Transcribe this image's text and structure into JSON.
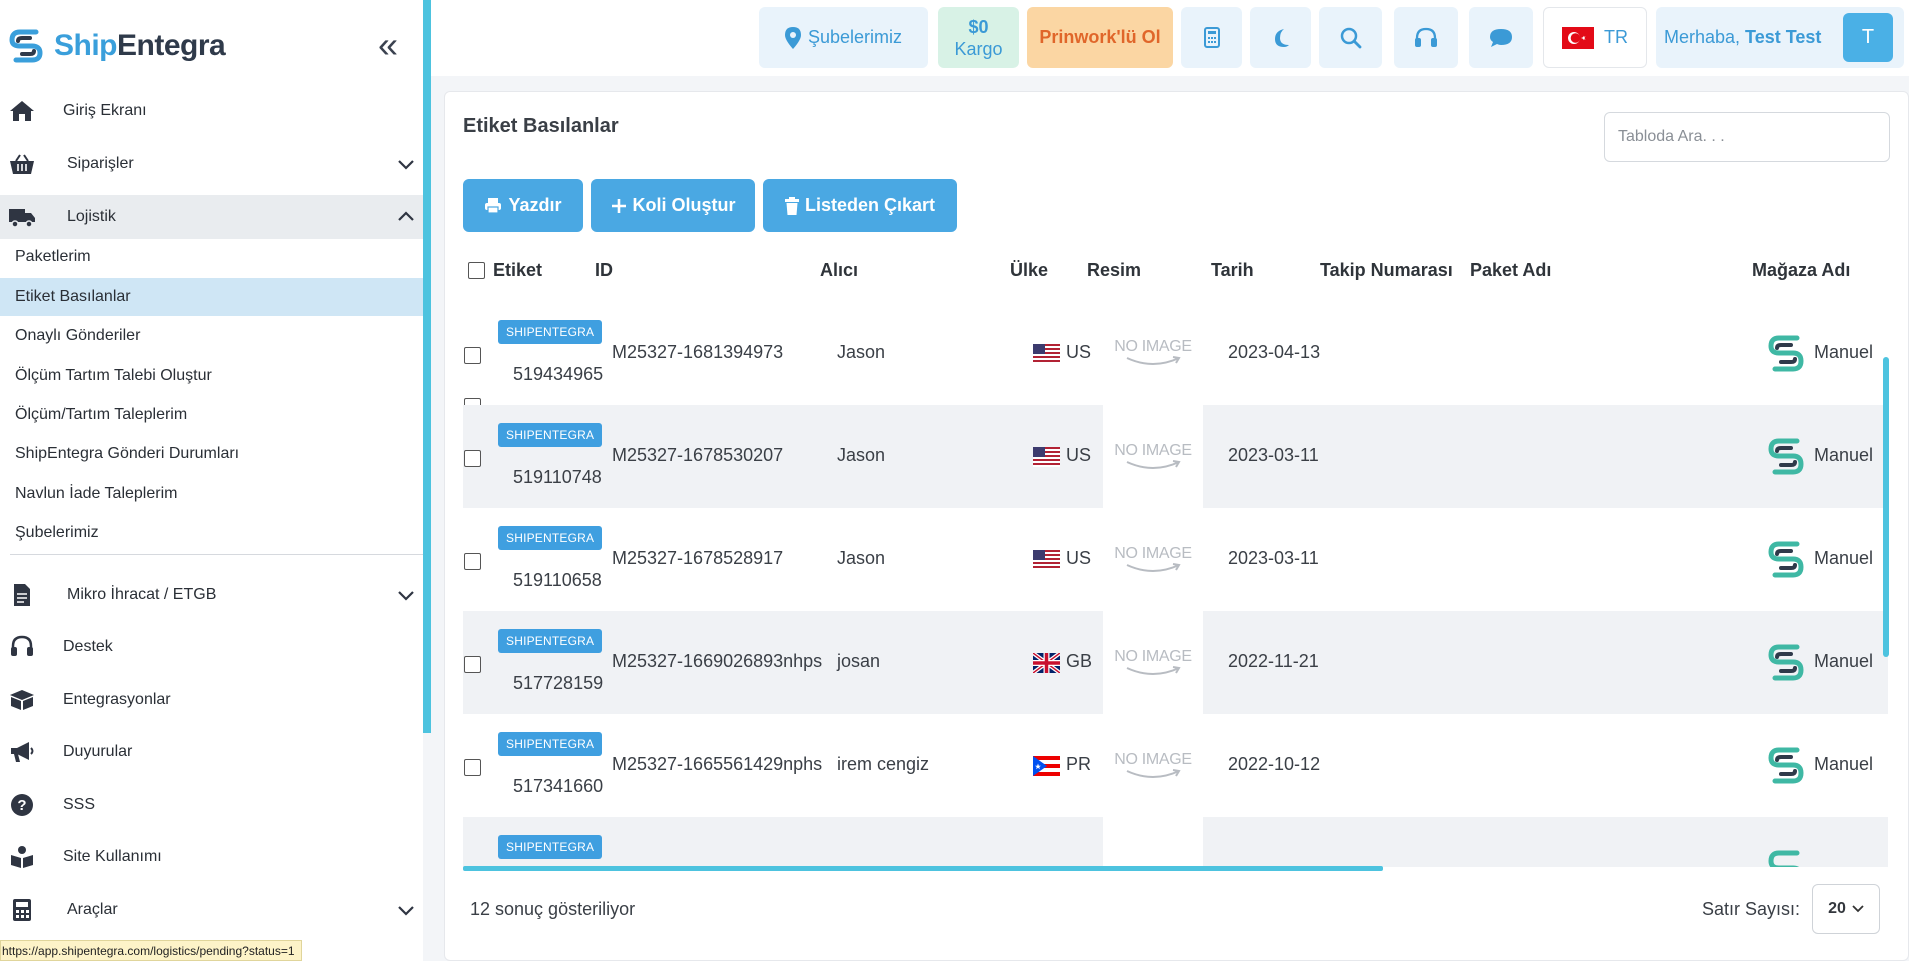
{
  "brand": {
    "part1": "Ship",
    "part2": "Entegra"
  },
  "sidebar": {
    "items": [
      {
        "label": "Giriş Ekranı"
      },
      {
        "label": "Siparişler"
      },
      {
        "label": "Lojistik"
      },
      {
        "label": "Mikro İhracat / ETGB"
      },
      {
        "label": "Destek"
      },
      {
        "label": "Entegrasyonlar"
      },
      {
        "label": "Duyurular"
      },
      {
        "label": "SSS"
      },
      {
        "label": "Site Kullanımı"
      },
      {
        "label": "Araçlar"
      }
    ],
    "sub_items": [
      {
        "label": "Paketlerim"
      },
      {
        "label": "Etiket Basılanlar"
      },
      {
        "label": "Onaylı Gönderiler"
      },
      {
        "label": "Ölçüm Tartım Talebi Oluştur"
      },
      {
        "label": "Ölçüm/Tartım Taleplerim"
      },
      {
        "label": "ShipEntegra Gönderi Durumları"
      },
      {
        "label": "Navlun İade Taleplerim"
      },
      {
        "label": "Şubelerimiz"
      }
    ]
  },
  "status_url": "https://app.shipentegra.com/logistics/pending?status=1",
  "topbar": {
    "branches": "Şubelerimiz",
    "balance_amount": "$0",
    "balance_label": "Kargo",
    "promo": "Prinwork'lü Ol",
    "lang": "TR",
    "greeting": "Merhaba,",
    "user_name": "Test Test",
    "avatar_initial": "T"
  },
  "page": {
    "title": "Etiket Basılanlar",
    "search_placeholder": "Tabloda Ara. . .",
    "buttons": {
      "print": "Yazdır",
      "create_box": "Koli Oluştur",
      "remove": "Listeden Çıkart"
    }
  },
  "table": {
    "headers": [
      "Etiket",
      "ID",
      "Alıcı",
      "Ülke",
      "Resim",
      "Tarih",
      "Takip Numarası",
      "Paket Adı",
      "Mağaza Adı"
    ],
    "no_image_text": "NO IMAGE",
    "rows": [
      {
        "badge": "SHIPENTEGRA",
        "label_no": "519434965",
        "id": "M25327-1681394973",
        "recipient": "Jason",
        "country": "US",
        "date": "2023-04-13",
        "store": "Manuel"
      },
      {
        "badge": "SHIPENTEGRA",
        "label_no": "519110748",
        "id": "M25327-1678530207",
        "recipient": "Jason",
        "country": "US",
        "date": "2023-03-11",
        "store": "Manuel"
      },
      {
        "badge": "SHIPENTEGRA",
        "label_no": "519110658",
        "id": "M25327-1678528917",
        "recipient": "Jason",
        "country": "US",
        "date": "2023-03-11",
        "store": "Manuel"
      },
      {
        "badge": "SHIPENTEGRA",
        "label_no": "517728159",
        "id": "M25327-1669026893nhps",
        "recipient": "josan",
        "country": "GB",
        "date": "2022-11-21",
        "store": "Manuel"
      },
      {
        "badge": "SHIPENTEGRA",
        "label_no": "517341660",
        "id": "M25327-1665561429nphs",
        "recipient": "irem cengiz",
        "country": "PR",
        "date": "2022-10-12",
        "store": "Manuel"
      },
      {
        "badge": "SHIPENTEGRA",
        "label_no": "",
        "id": "",
        "recipient": "",
        "country": "",
        "date": "",
        "store": ""
      }
    ]
  },
  "footer": {
    "count_text": "12 sonuç gösteriliyor",
    "rows_label": "Satır Sayısı:",
    "rows_value": "20"
  }
}
